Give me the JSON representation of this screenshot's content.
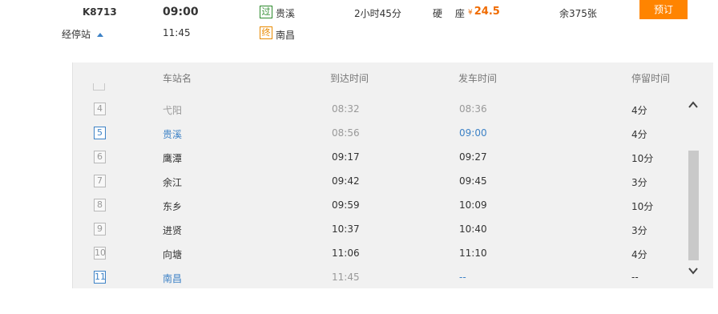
{
  "train": {
    "number": "K8713",
    "depart_time": "09:00",
    "arrive_time": "11:45",
    "via_label": "经停站",
    "from_badge": "过",
    "from_station": "贵溪",
    "to_badge": "终",
    "to_station": "南昌",
    "duration": "2小时45分",
    "seat_type": "硬 座",
    "price_symbol": "¥",
    "price": "24.5",
    "remaining": "余375张",
    "book_label": "预订"
  },
  "stops_table": {
    "headers": [
      "车站名",
      "到达时间",
      "发车时间",
      "停留时间"
    ],
    "rows": [
      {
        "no": "4",
        "station": "弋阳",
        "arrive": "08:32",
        "depart": "08:36",
        "stay": "4分",
        "state": "past"
      },
      {
        "no": "5",
        "station": "贵溪",
        "arrive": "08:56",
        "depart": "09:00",
        "stay": "4分",
        "state": "boarding"
      },
      {
        "no": "6",
        "station": "鹰潭",
        "arrive": "09:17",
        "depart": "09:27",
        "stay": "10分",
        "state": "normal"
      },
      {
        "no": "7",
        "station": "余江",
        "arrive": "09:42",
        "depart": "09:45",
        "stay": "3分",
        "state": "normal"
      },
      {
        "no": "8",
        "station": "东乡",
        "arrive": "09:59",
        "depart": "10:09",
        "stay": "10分",
        "state": "normal"
      },
      {
        "no": "9",
        "station": "进贤",
        "arrive": "10:37",
        "depart": "10:40",
        "stay": "3分",
        "state": "normal"
      },
      {
        "no": "10",
        "station": "向塘",
        "arrive": "11:06",
        "depart": "11:10",
        "stay": "4分",
        "state": "normal"
      },
      {
        "no": "11",
        "station": "南昌",
        "arrive": "11:45",
        "depart": "--",
        "stay": "--",
        "state": "terminal"
      }
    ]
  },
  "colors": {
    "accent_blue": "#3d82c6",
    "price_orange": "#f06b00",
    "book_button": "#ff8400",
    "pass_badge": "#2e8b2e",
    "end_badge": "#e88a00"
  },
  "icons": {
    "via_toggle": "triangle-up-icon",
    "scroll_up": "chevron-up-icon",
    "scroll_down": "chevron-down-icon"
  }
}
